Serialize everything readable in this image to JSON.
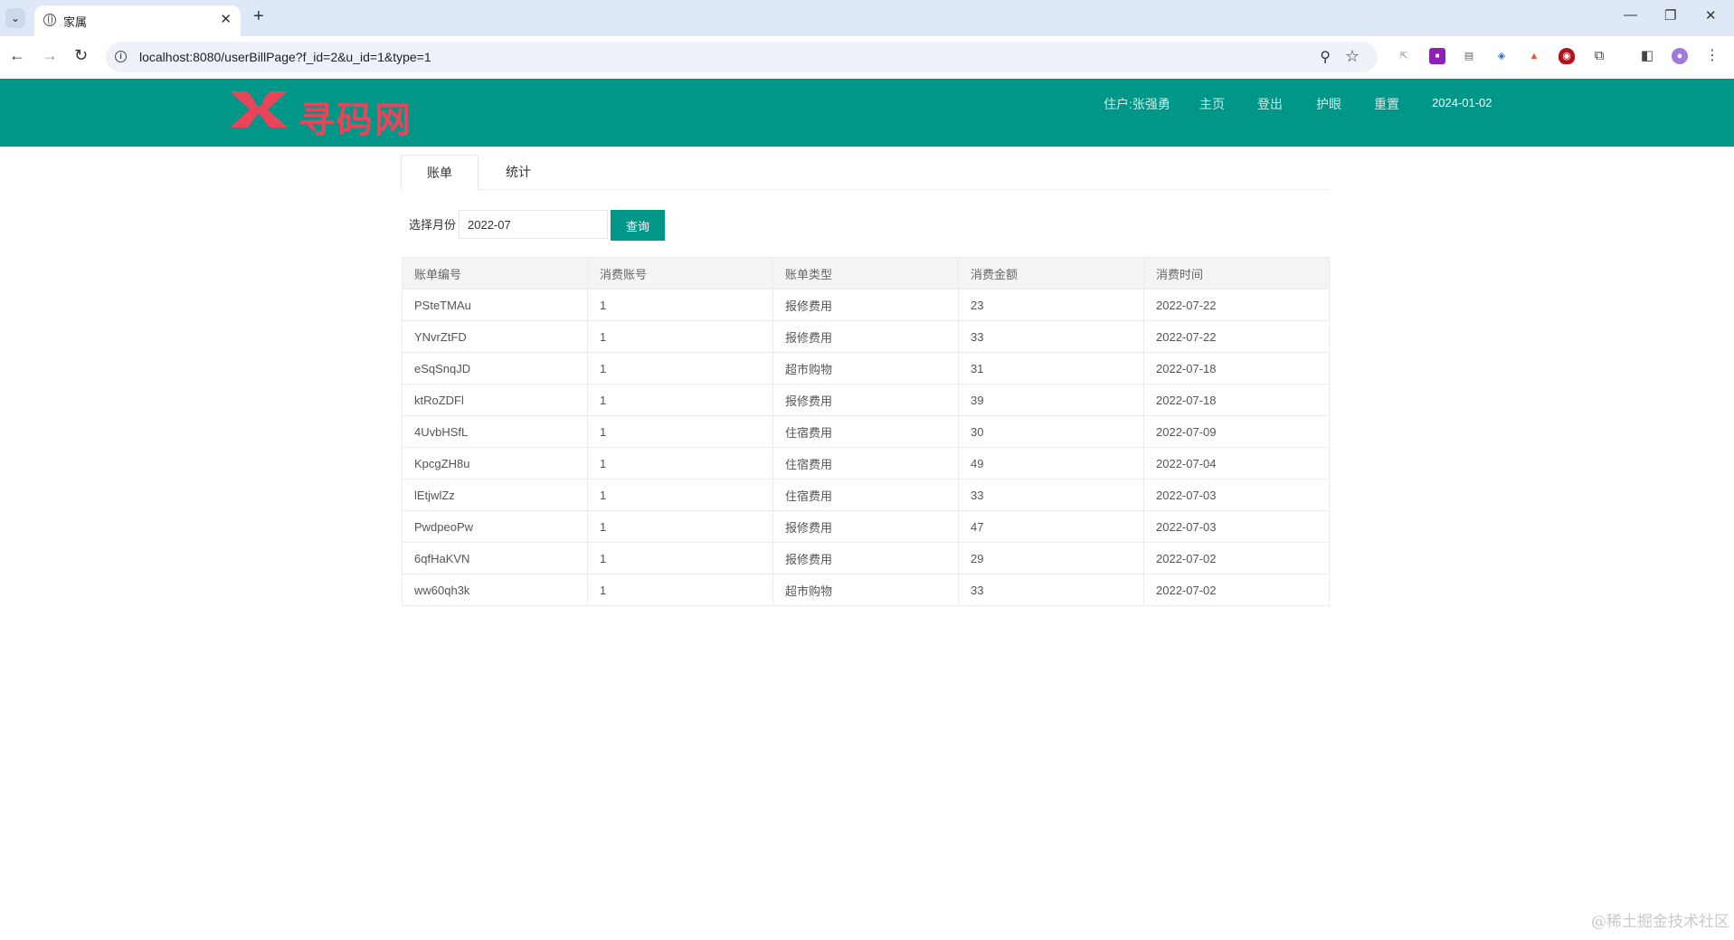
{
  "browser": {
    "tab_title": "家属",
    "url": "localhost:8080/userBillPage?f_id=2&u_id=1&type=1",
    "tab_list_icon": "chevron-down-icon",
    "close_glyph": "✕",
    "new_tab_glyph": "+",
    "window_controls": [
      "—",
      "❐",
      "✕"
    ]
  },
  "header": {
    "logo_text": "寻码网",
    "nav": [
      "住户:张强勇",
      "主页",
      "登出",
      "护眼",
      "重置"
    ],
    "date": "2024-01-02",
    "colors": {
      "primary": "#009688",
      "logo": "#e8455a"
    }
  },
  "tabs": [
    "账单",
    "统计"
  ],
  "filter": {
    "label": "选择月份",
    "month": "2022-07",
    "query_button": "查询"
  },
  "table": {
    "columns": [
      "账单编号",
      "消费账号",
      "账单类型",
      "消费金额",
      "消费时间"
    ],
    "rows": [
      [
        "PSteTMAu",
        "1",
        "报修费用",
        "23",
        "2022-07-22"
      ],
      [
        "YNvrZtFD",
        "1",
        "报修费用",
        "33",
        "2022-07-22"
      ],
      [
        "eSqSnqJD",
        "1",
        "超市购物",
        "31",
        "2022-07-18"
      ],
      [
        "ktRoZDFl",
        "1",
        "报修费用",
        "39",
        "2022-07-18"
      ],
      [
        "4UvbHSfL",
        "1",
        "住宿费用",
        "30",
        "2022-07-09"
      ],
      [
        "KpcgZH8u",
        "1",
        "住宿费用",
        "49",
        "2022-07-04"
      ],
      [
        "lEtjwlZz",
        "1",
        "住宿费用",
        "33",
        "2022-07-03"
      ],
      [
        "PwdpeoPw",
        "1",
        "报修费用",
        "47",
        "2022-07-03"
      ],
      [
        "6qfHaKVN",
        "1",
        "报修费用",
        "29",
        "2022-07-02"
      ],
      [
        "ww60qh3k",
        "1",
        "超市购物",
        "33",
        "2022-07-02"
      ]
    ]
  },
  "watermark": "@稀土掘金技术社区"
}
